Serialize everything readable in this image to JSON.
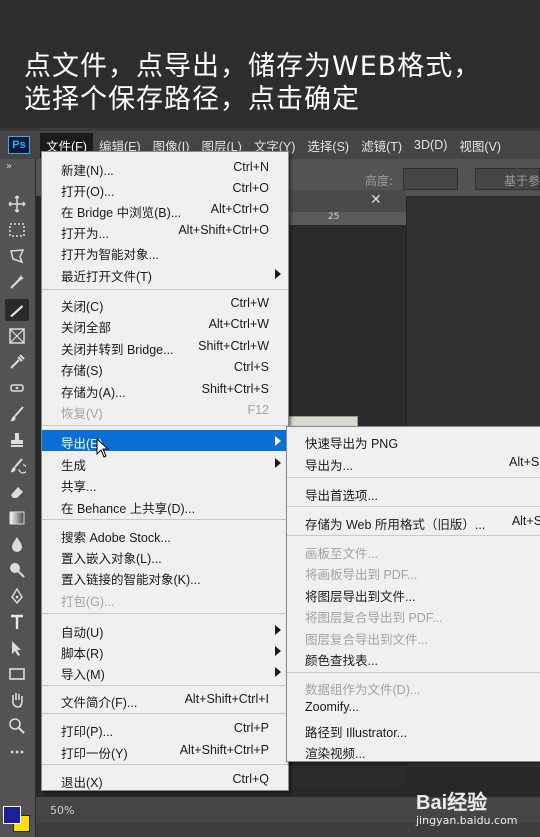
{
  "caption": {
    "line1": "点文件，点导出，储存为WEB格式，",
    "line2": "选择个保存路径，点击确定"
  },
  "app": {
    "logo": "Ps"
  },
  "menubar": {
    "items": [
      {
        "label": "文件(F)",
        "active": true
      },
      {
        "label": "编辑(E)"
      },
      {
        "label": "图像(I)"
      },
      {
        "label": "图层(L)"
      },
      {
        "label": "文字(Y)"
      },
      {
        "label": "选择(S)"
      },
      {
        "label": "滤镜(T)"
      },
      {
        "label": "3D(D)"
      },
      {
        "label": "视图(V)"
      }
    ]
  },
  "options_bar": {
    "height_label": "高度:",
    "ref_label": "基于参"
  },
  "file_menu": {
    "items": [
      {
        "label": "新建(N)...",
        "shortcut": "Ctrl+N"
      },
      {
        "label": "打开(O)...",
        "shortcut": "Ctrl+O"
      },
      {
        "label": "在 Bridge 中浏览(B)...",
        "shortcut": "Alt+Ctrl+O"
      },
      {
        "label": "打开为...",
        "shortcut": "Alt+Shift+Ctrl+O"
      },
      {
        "label": "打开为智能对象..."
      },
      {
        "label": "最近打开文件(T)"
      },
      {
        "label": "关闭(C)",
        "shortcut": "Ctrl+W"
      },
      {
        "label": "关闭全部",
        "shortcut": "Alt+Ctrl+W"
      },
      {
        "label": "关闭并转到 Bridge...",
        "shortcut": "Shift+Ctrl+W"
      },
      {
        "label": "存储(S)",
        "shortcut": "Ctrl+S"
      },
      {
        "label": "存储为(A)...",
        "shortcut": "Shift+Ctrl+S"
      },
      {
        "label": "恢复(V)",
        "shortcut": "F12"
      },
      {
        "label": "导出(E)"
      },
      {
        "label": "生成"
      },
      {
        "label": "共享..."
      },
      {
        "label": "在 Behance 上共享(D)..."
      },
      {
        "label": "搜索 Adobe Stock..."
      },
      {
        "label": "置入嵌入对象(L)..."
      },
      {
        "label": "置入链接的智能对象(K)..."
      },
      {
        "label": "打包(G)..."
      },
      {
        "label": "自动(U)"
      },
      {
        "label": "脚本(R)"
      },
      {
        "label": "导入(M)"
      },
      {
        "label": "文件简介(F)...",
        "shortcut": "Alt+Shift+Ctrl+I"
      },
      {
        "label": "打印(P)...",
        "shortcut": "Ctrl+P"
      },
      {
        "label": "打印一份(Y)",
        "shortcut": "Alt+Shift+Ctrl+P"
      },
      {
        "label": "退出(X)",
        "shortcut": "Ctrl+Q"
      }
    ]
  },
  "export_submenu": {
    "items": [
      {
        "label": "快速导出为 PNG"
      },
      {
        "label": "导出为...",
        "shortcut": "Alt+Shi"
      },
      {
        "label": "导出首选项..."
      },
      {
        "label": "存储为 Web 所用格式（旧版）...",
        "shortcut": "Alt+Sh"
      },
      {
        "label": "画板至文件..."
      },
      {
        "label": "将画板导出到 PDF..."
      },
      {
        "label": "将图层导出到文件..."
      },
      {
        "label": "将图层复合导出到 PDF..."
      },
      {
        "label": "图层复合导出到文件..."
      },
      {
        "label": "颜色查找表..."
      },
      {
        "label": "数据组作为文件(D)..."
      },
      {
        "label": "Zoomify..."
      },
      {
        "label": "路径到 Illustrator..."
      },
      {
        "label": "渲染视频..."
      }
    ]
  },
  "document": {
    "ruler_mark": "25",
    "close": "✕"
  },
  "status": {
    "zoom": "50%"
  },
  "watermark": {
    "logo": "Bai经验",
    "url": "jingyan.baidu.com"
  },
  "colors": {
    "foreground": "#1a1f9a",
    "background": "#ffe000",
    "highlight": "#0a6fd6"
  }
}
